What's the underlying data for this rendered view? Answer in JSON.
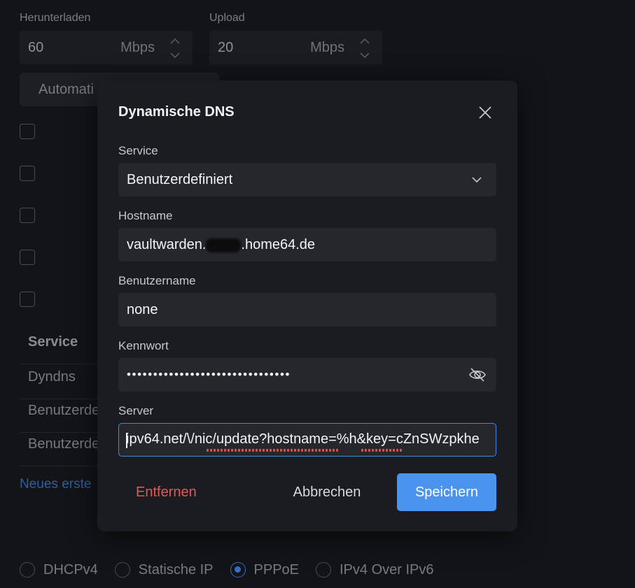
{
  "background": {
    "download_label": "Herunterladen",
    "download_value": "60",
    "download_unit": "Mbps",
    "upload_label": "Upload",
    "upload_value": "20",
    "upload_unit": "Mbps",
    "auto_button_label": "Automati",
    "table": {
      "header": "Service",
      "rows": [
        "Dyndns",
        "Benutzerde",
        "Benutzerde"
      ]
    },
    "new_link": "Neues erste",
    "connection_types": [
      {
        "label": "DHCPv4",
        "selected": false
      },
      {
        "label": "Statische IP",
        "selected": false
      },
      {
        "label": "PPPoE",
        "selected": true
      },
      {
        "label": "IPv4 Over IPv6",
        "selected": false
      }
    ]
  },
  "modal": {
    "title": "Dynamische DNS",
    "service": {
      "label": "Service",
      "value": "Benutzerdefiniert"
    },
    "hostname": {
      "label": "Hostname",
      "value_prefix": "vaultwarden.",
      "value_suffix": ".home64.de"
    },
    "username": {
      "label": "Benutzername",
      "value": "none"
    },
    "password": {
      "label": "Kennwort",
      "value": "•••••••••••••••••••••••••••••••"
    },
    "server": {
      "label": "Server",
      "value": "ipv64.net/\\/nic/update?hostname=%h&key=cZnSWzpkhe"
    },
    "buttons": {
      "remove": "Entfernen",
      "cancel": "Abbrechen",
      "save": "Speichern"
    }
  },
  "colors": {
    "accent": "#4a94f0",
    "danger": "#e05a5a",
    "modal_bg": "#1b1c21",
    "page_bg": "#131418"
  }
}
